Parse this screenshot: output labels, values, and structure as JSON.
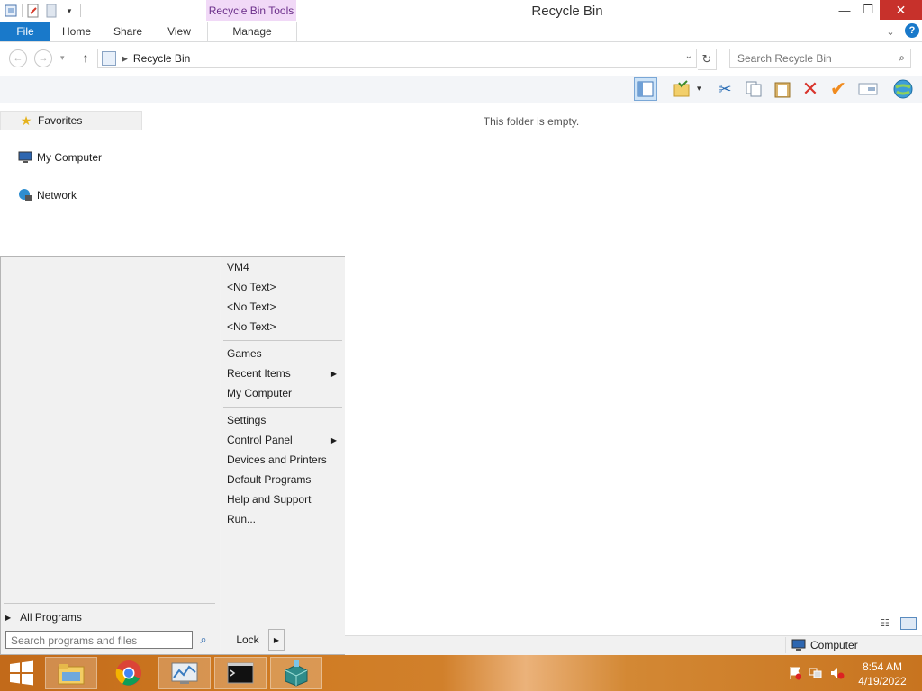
{
  "window": {
    "title": "Recycle Bin",
    "contextual_tab": "Recycle Bin Tools",
    "controls": {
      "minimize": "—",
      "maximize": "❐",
      "close": "✕"
    }
  },
  "ribbon": {
    "file_tab": "File",
    "tabs": [
      "Home",
      "Share",
      "View",
      "Manage"
    ],
    "help": "?"
  },
  "address_bar": {
    "breadcrumb": "Recycle Bin",
    "search_placeholder": "Search Recycle Bin"
  },
  "toolbar": {
    "icons": [
      "preview-pane-icon",
      "folder-options-icon",
      "cut-icon",
      "copy-icon",
      "paste-icon",
      "delete-icon",
      "check-icon",
      "rename-icon",
      "globe-icon"
    ]
  },
  "nav_pane": {
    "items": [
      {
        "label": "Favorites",
        "icon": "star-icon"
      },
      {
        "label": "My Computer",
        "icon": "computer-icon"
      },
      {
        "label": "Network",
        "icon": "network-icon"
      }
    ]
  },
  "content": {
    "empty_message": "This folder is empty."
  },
  "status_bar": {
    "location": "Computer"
  },
  "start_menu": {
    "right_items_group1": [
      "VM4",
      "<No Text>",
      "<No Text>",
      "<No Text>"
    ],
    "right_items_group2": [
      {
        "label": "Games",
        "submenu": false
      },
      {
        "label": "Recent Items",
        "submenu": true
      },
      {
        "label": "My Computer",
        "submenu": false
      }
    ],
    "right_items_group3": [
      {
        "label": "Settings",
        "submenu": false
      },
      {
        "label": "Control Panel",
        "submenu": true
      },
      {
        "label": "Devices and Printers",
        "submenu": false
      },
      {
        "label": "Default Programs",
        "submenu": false
      },
      {
        "label": "Help and Support",
        "submenu": false
      },
      {
        "label": "Run...",
        "submenu": false
      }
    ],
    "all_programs": "All Programs",
    "search_placeholder": "Search programs and files",
    "lock": "Lock"
  },
  "taskbar": {
    "apps": [
      "file-explorer-icon",
      "chrome-icon",
      "performance-monitor-icon",
      "command-prompt-icon",
      "package-icon"
    ],
    "clock_time": "8:54 AM",
    "clock_date": "4/19/2022",
    "colors": {
      "taskbar": "#cf7b22",
      "file_tab": "#1979ca",
      "close": "#c7312b",
      "tools_tab": "#f1d9f7"
    }
  }
}
